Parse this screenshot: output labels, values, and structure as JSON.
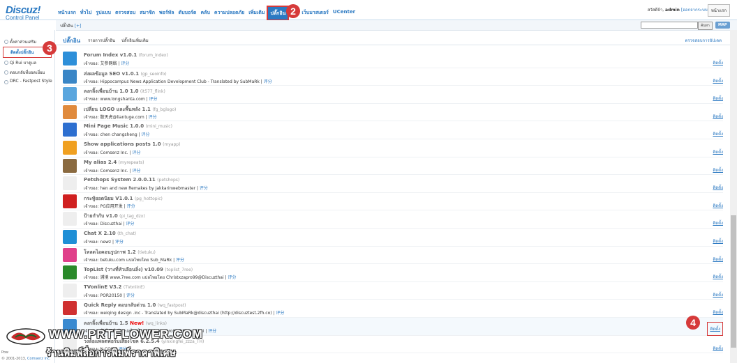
{
  "header": {
    "logo": "Discuz!",
    "logo_sub": "Control Panel",
    "nav": [
      "หน้าแรก",
      "ทั่วไป",
      "รูปแบบ",
      "ตรวจสอบ",
      "สมาชิก",
      "พอร์ทัล",
      "ดับบอร์ด",
      "คลับ",
      "ความปลอดภัย",
      "เพิ่มเติม",
      "ปลั๊กอิน",
      "ดับ",
      "เว็บมาสเตอร์",
      "UCenter"
    ],
    "active_nav": "ปลั๊กอิน",
    "user_greeting": "สวัสดีจ้า,",
    "user_name": "admin",
    "logout": "[ออกจากระบบ]",
    "home_button": "หน้าแรก"
  },
  "subbar": {
    "crumb": "ปลั๊กอิน",
    "crumb_link": "[+]",
    "search_button": "ค้นหา",
    "map_button": "MAP"
  },
  "sidebar": {
    "items": [
      "ตั้งค่าส่วนเสริม",
      "ติดตั้งปลั๊กอิน",
      "Qi Rui บาดูแล",
      "ตอบกลับที่ยอดเยี่ยม",
      "DRC - Fastpost Style"
    ],
    "selected": "ติดตั้งปลั๊กอิน"
  },
  "footer": {
    "powered": "Pow",
    "copyright": "© 2001-2013, ",
    "company": "Comsenz Inc."
  },
  "main": {
    "title": "ปลั๊กอิน",
    "tabs": [
      "รายการปลั๊กอิน",
      "ปลั๊กอินเพิ่มเติม"
    ],
    "check_update": "ตรวจสอบการอัปเดต",
    "install_label": "ติดตั้ง",
    "author_prefix": "เจ้าของ:",
    "review_label": "评分",
    "plugins": [
      {
        "name": "Forum Index v1.0.1",
        "id": "(forum_index)",
        "author": "艾参网络",
        "color": "#2d8fd9"
      },
      {
        "name": "ส่งผลข้อมูล SEO v1.0.1",
        "id": "(gp_seoinfo)",
        "author": "Hippocampus News Application Development Club - Translated by SubMaRk",
        "color": "#3a86c6"
      },
      {
        "name": "ลงกลิ้งเพื่อนบ้าน 1.0 1.0",
        "id": "(it577_flink)",
        "author": "www.longshanta.com",
        "color": "#5aa6de"
      },
      {
        "name": "เปลี่ยน LOGO และพื้นหลัง 1.1",
        "id": "(fg_bglogo)",
        "author": "散天虎@liantuge.com",
        "color": "#e08a3c"
      },
      {
        "name": "Mini Page Music 1.0.0",
        "id": "(mini_music)",
        "author": "chen changsheng",
        "color": "#2d6fd0"
      },
      {
        "name": "Show applications posts 1.0",
        "id": "(myapp)",
        "author": "Comsenz Inc.",
        "color": "#f0a020"
      },
      {
        "name": "My alias 2.4",
        "id": "(myrepeats)",
        "author": "Comsenz Inc.",
        "color": "#8a6a40"
      },
      {
        "name": "Petshops System 2.0.0.11",
        "id": "(petshops)",
        "author": "hen and new Remakes by Jakkarinwebmaster",
        "color": "#eeeeee"
      },
      {
        "name": "กระทู้ยอดนิยม V1.0.1",
        "id": "(pg_hottopic)",
        "author": "PG应用开发",
        "color": "#d02020"
      },
      {
        "name": "ป้ายกำกับ v1.0",
        "id": "(pi_tag_dzx)",
        "author": "Discuzthai",
        "color": "#eeeeee"
      },
      {
        "name": "Chat X 2.10",
        "id": "(th_chat)",
        "author": "newz",
        "color": "#1f8fd6"
      },
      {
        "name": "โหลดไอคอนรูปภาพ 1.2",
        "id": "(tietuku)",
        "author": "betuku.com แปลไทยโดย Sub_MaRk",
        "color": "#e0408a"
      },
      {
        "name": "TopList (วางที่หัวเลือนลิ่ง) v10.09",
        "id": "(toplist_7ree)",
        "author": "浦境 www.7ree.com แปลไทยโดย Christxzapro99@Discuzthai",
        "color": "#2a8a2a"
      },
      {
        "name": "TVonlinE V3.2",
        "id": "(TVonlinE)",
        "author": "POR20150",
        "color": "#eeeeee"
      },
      {
        "name": "Quick Reply ตอบกลับด่วน 1.0",
        "id": "(wq_fastpost)",
        "author": "weiqing design .inc - Translated by SubMaRk@discuzthai (http://discuztest.2fh.co)",
        "color": "#d03030"
      },
      {
        "name": "ลงกลิ้งเพื่อนบ้าน 1.5",
        "id": "(wq_links)",
        "author": "蒲溝工作室 แปลไทยโดย Christxzapro99@Discuzthai",
        "color": "#3a8ad0",
        "new": "New!"
      },
      {
        "name": "วงล้อแพลตฟอร์มเสี่ยงโชค 6.2.5.4",
        "id": "(yinxingfei_zzza_TH)",
        "author": "N.COM",
        "color": "#eeeeee"
      }
    ]
  },
  "watermark": {
    "line1": "WWW.PRTFLOWER.COM",
    "line2": "ร้านพิมพ์สื่อการพิมพ์ราคาพิเศษ"
  },
  "callouts": [
    "2",
    "3",
    "4"
  ]
}
